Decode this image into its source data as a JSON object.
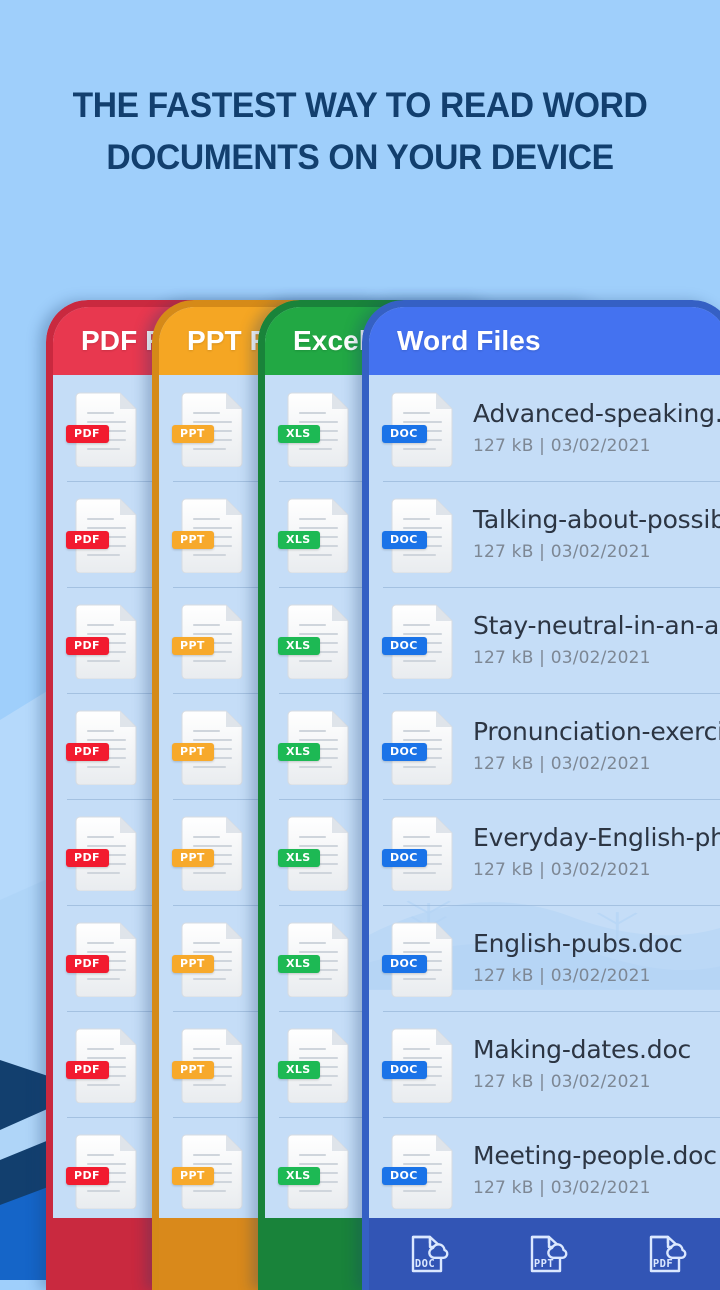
{
  "headline": {
    "line1": "THE FASTEST WAY TO READ WORD",
    "line2": "DOCUMENTS ON YOUR DEVICE",
    "color": "#123f6e"
  },
  "background": {
    "sky": "#9fcffb",
    "hill_light": "#bcdcfb",
    "hill_mid": "#8ebdee",
    "hill_dark": "#123f6e",
    "hill_accent": "#1565c8"
  },
  "cards": [
    {
      "id": "pdf",
      "title": "PDF Files",
      "accent": "#e8384f",
      "bezel": "#c9293f",
      "badge_label": "PDF",
      "badge_color": "#f21b2f",
      "bottom_bar": "#c9293f"
    },
    {
      "id": "ppt",
      "title": "PPT Files",
      "accent": "#f5a623",
      "bezel": "#d58a18",
      "badge_label": "PPT",
      "badge_color": "#f7a92b",
      "bottom_bar": "#d9891b"
    },
    {
      "id": "excel",
      "title": "Excel Files",
      "accent": "#22a844",
      "bezel": "#19833a",
      "badge_label": "XLS",
      "badge_color": "#1db954",
      "bottom_bar": "#19833a"
    },
    {
      "id": "word",
      "title": "Word Files",
      "accent": "#4472f0",
      "bezel": "#3560c4",
      "badge_label": "DOC",
      "badge_color": "#1a73e8",
      "bottom_bar": "#3255b5"
    }
  ],
  "word_files": [
    {
      "name": "Advanced-speaking.doc",
      "meta": "127 kB | 03/02/2021"
    },
    {
      "name": "Talking-about-possibility.doc",
      "meta": "127 kB | 03/02/2021"
    },
    {
      "name": "Stay-neutral-in-an-argument.doc",
      "meta": "127 kB | 03/02/2021"
    },
    {
      "name": "Pronunciation-exercise.doc",
      "meta": "127 kB | 03/02/2021"
    },
    {
      "name": "Everyday-English-phrases.doc",
      "meta": "127 kB | 03/02/2021"
    },
    {
      "name": "English-pubs.doc",
      "meta": "127 kB | 03/02/2021"
    },
    {
      "name": "Making-dates.doc",
      "meta": "127 kB | 03/02/2021"
    },
    {
      "name": "Meeting-people.doc",
      "meta": "127 kB | 03/02/2021"
    }
  ],
  "bottom_nav": {
    "items": [
      {
        "label": "DOC",
        "icon": "doc-cloud-icon"
      },
      {
        "label": "PPT",
        "icon": "ppt-cloud-icon"
      },
      {
        "label": "PDF",
        "icon": "pdf-cloud-icon"
      }
    ]
  },
  "stacked_nav_label": "DOC"
}
